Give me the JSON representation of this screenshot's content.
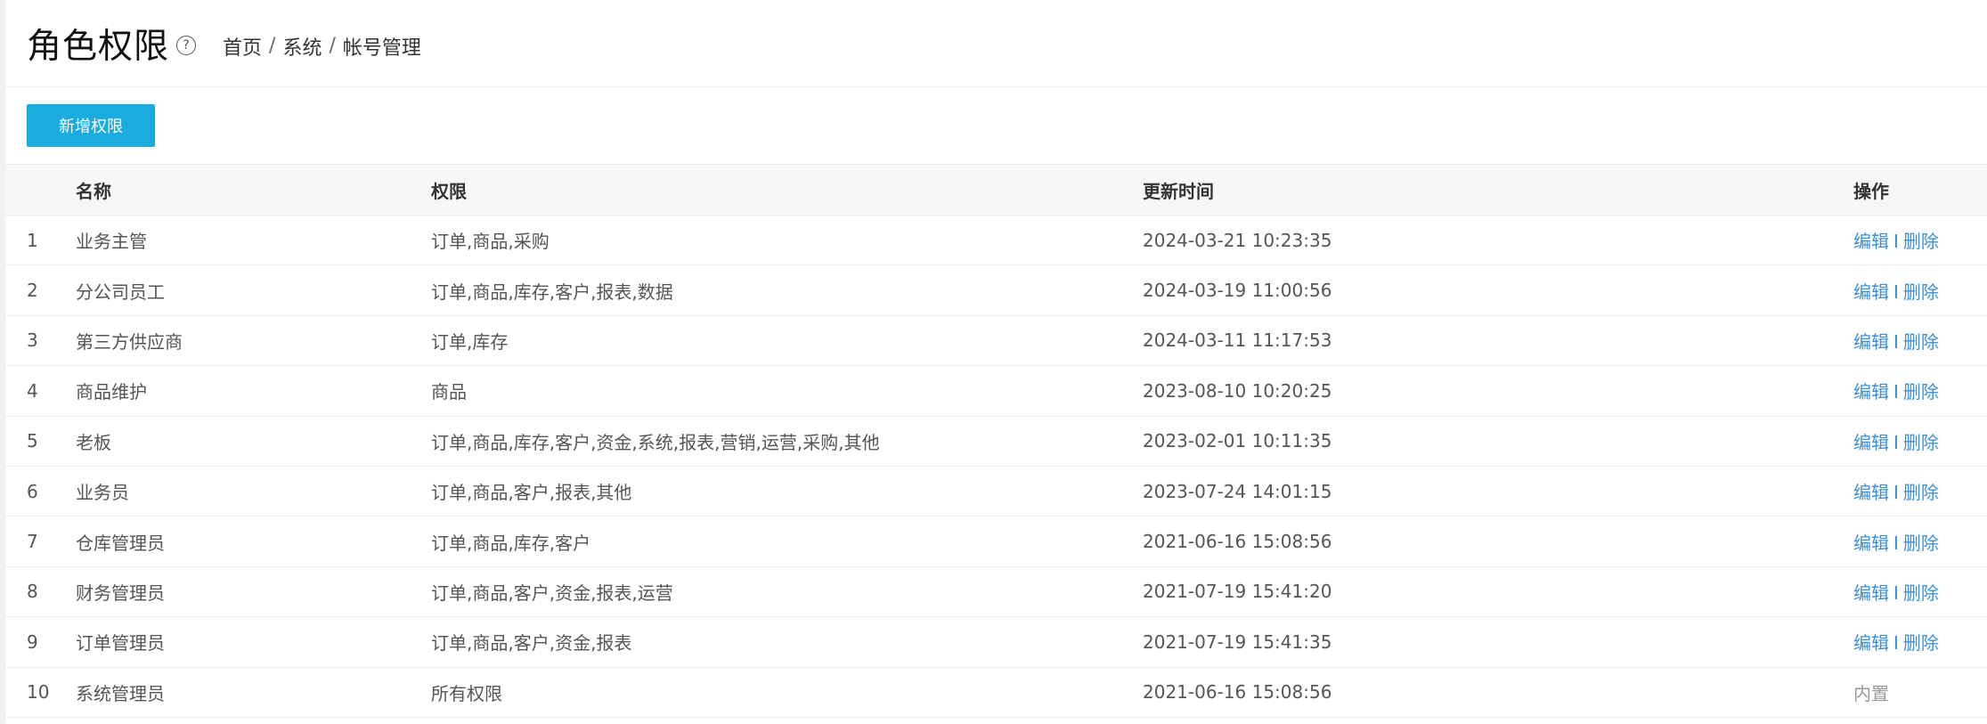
{
  "header": {
    "title": "角色权限",
    "help_icon": "question-circle-icon",
    "breadcrumb": [
      "首页",
      "系统",
      "帐号管理"
    ],
    "breadcrumb_sep": "/"
  },
  "toolbar": {
    "add_label": "新增权限"
  },
  "table": {
    "columns": [
      "",
      "名称",
      "权限",
      "更新时间",
      "操作"
    ],
    "rows": [
      {
        "idx": "1",
        "name": "业务主管",
        "perms": "订单,商品,采购",
        "time": "2024-03-21 10:23:35",
        "edit": "编辑",
        "sep": "I",
        "del": "删除"
      },
      {
        "idx": "2",
        "name": "分公司员工",
        "perms": "订单,商品,库存,客户,报表,数据",
        "time": "2024-03-19 11:00:56",
        "edit": "编辑",
        "sep": "I",
        "del": "删除"
      },
      {
        "idx": "3",
        "name": "第三方供应商",
        "perms": "订单,库存",
        "time": "2024-03-11 11:17:53",
        "edit": "编辑",
        "sep": "I",
        "del": "删除"
      },
      {
        "idx": "4",
        "name": "商品维护",
        "perms": "商品",
        "time": "2023-08-10 10:20:25",
        "edit": "编辑",
        "sep": "I",
        "del": "删除"
      },
      {
        "idx": "5",
        "name": "老板",
        "perms": "订单,商品,库存,客户,资金,系统,报表,营销,运营,采购,其他",
        "time": "2023-02-01 10:11:35",
        "edit": "编辑",
        "sep": "I",
        "del": "删除"
      },
      {
        "idx": "6",
        "name": "业务员",
        "perms": "订单,商品,客户,报表,其他",
        "time": "2023-07-24 14:01:15",
        "edit": "编辑",
        "sep": "I",
        "del": "删除"
      },
      {
        "idx": "7",
        "name": "仓库管理员",
        "perms": "订单,商品,库存,客户",
        "time": "2021-06-16 15:08:56",
        "edit": "编辑",
        "sep": "I",
        "del": "删除"
      },
      {
        "idx": "8",
        "name": "财务管理员",
        "perms": "订单,商品,客户,资金,报表,运营",
        "time": "2021-07-19 15:41:20",
        "edit": "编辑",
        "sep": "I",
        "del": "删除"
      },
      {
        "idx": "9",
        "name": "订单管理员",
        "perms": "订单,商品,客户,资金,报表",
        "time": "2021-07-19 15:41:35",
        "edit": "编辑",
        "sep": "I",
        "del": "删除"
      },
      {
        "idx": "10",
        "name": "系统管理员",
        "perms": "所有权限",
        "time": "2021-06-16 15:08:56",
        "builtin": "内置"
      }
    ]
  },
  "colors": {
    "accent": "#1aabdf",
    "link": "#3c8fd6",
    "muted": "#999999"
  }
}
